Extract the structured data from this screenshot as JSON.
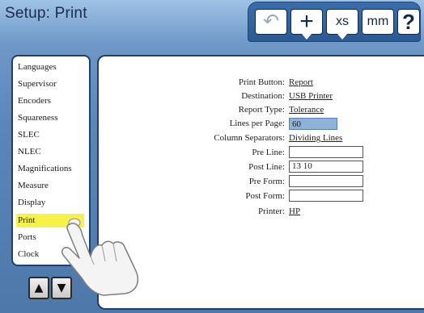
{
  "header": {
    "title": "Setup: Print"
  },
  "toolbar": {
    "undo_icon": "undo-icon",
    "undo_glyph": "↶",
    "plus_glyph": "+",
    "xs_label": "xs",
    "mm_label": "mm",
    "help_label": "?"
  },
  "sidebar": {
    "items": [
      {
        "label": "Languages"
      },
      {
        "label": "Supervisor"
      },
      {
        "label": "Encoders"
      },
      {
        "label": "Squareness"
      },
      {
        "label": "SLEC"
      },
      {
        "label": "NLEC"
      },
      {
        "label": "Magnifications"
      },
      {
        "label": "Measure"
      },
      {
        "label": "Display"
      },
      {
        "label": "Print",
        "selected": true
      },
      {
        "label": "Ports"
      },
      {
        "label": "Clock"
      }
    ],
    "scroll_up_glyph": "▲",
    "scroll_down_glyph": "▼"
  },
  "settings": {
    "print_button": {
      "label": "Print Button:",
      "value": "Report"
    },
    "destination": {
      "label": "Destination:",
      "value": "USB Printer"
    },
    "report_type": {
      "label": "Report Type:",
      "value": "Tolerance"
    },
    "lines_per_page": {
      "label": "Lines per Page:",
      "value": "60"
    },
    "column_separators": {
      "label": "Column Separators:",
      "value": "Dividing Lines"
    },
    "pre_line": {
      "label": "Pre Line:",
      "value": ""
    },
    "post_line": {
      "label": "Post Line:",
      "value": "13 10"
    },
    "pre_form": {
      "label": "Pre Form:",
      "value": ""
    },
    "post_form": {
      "label": "Post Form:",
      "value": ""
    },
    "printer": {
      "label": "Printer:",
      "value": "HP"
    }
  },
  "colors": {
    "selected_item": "#f6f24a",
    "highlight_field": "#8fb2d8",
    "toolbar_bg": "#2c5a93"
  }
}
